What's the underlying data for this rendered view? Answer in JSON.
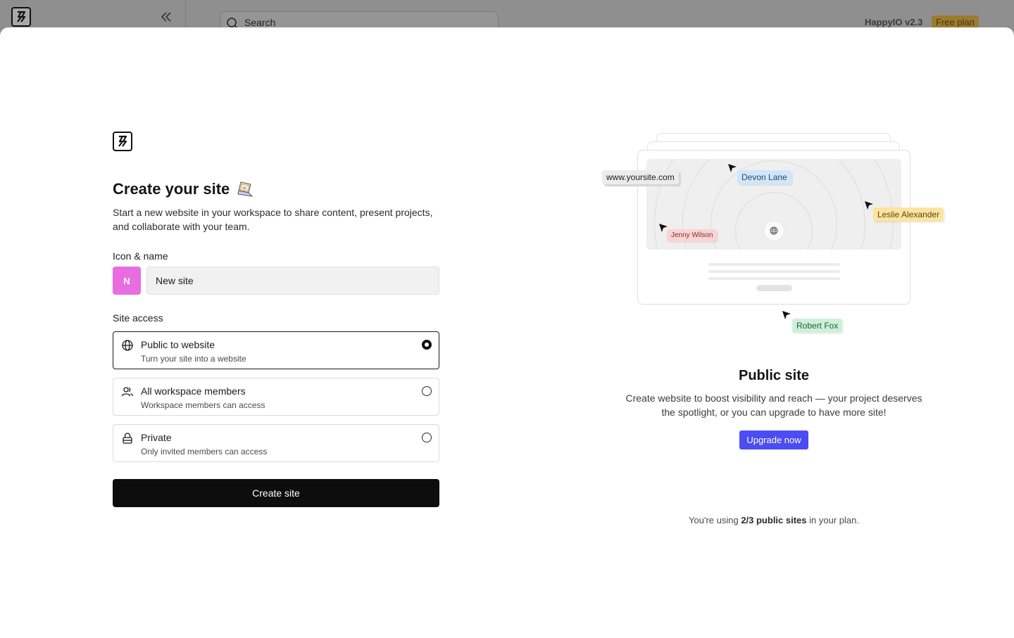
{
  "background": {
    "search_placeholder": "Search",
    "app_version": "HappyIO v2.3",
    "plan_badge": "Free plan"
  },
  "form": {
    "title": "Create your site",
    "subtitle": "Start a new website in your workspace to share content, present projects, and collaborate with your team.",
    "icon_name_label": "Icon & name",
    "icon_letter": "N",
    "name_value": "New site",
    "site_access_label": "Site access",
    "options": [
      {
        "title": "Public to website",
        "desc": "Turn your site into a website",
        "icon": "globe-icon",
        "selected": true
      },
      {
        "title": "All workspace members",
        "desc": "Workspace members can access",
        "icon": "users-icon",
        "selected": false
      },
      {
        "title": "Private",
        "desc": "Only invited members can access",
        "icon": "lock-icon",
        "selected": false
      }
    ],
    "create_label": "Create site"
  },
  "illustration": {
    "url": "www.yoursite.com",
    "collaborators": [
      "Devon Lane",
      "Leslie Alexander",
      "Jenny Wilson",
      "Robert Fox"
    ]
  },
  "promo": {
    "title": "Public site",
    "description": "Create website to boost visibility and reach — your project deserves the spotlight, or you can upgrade to have more site!",
    "upgrade_label": "Upgrade now",
    "usage_prefix": "You're using ",
    "usage_count": "2/3 public sites",
    "usage_suffix": " in your plan."
  },
  "colors": {
    "accent": "#4b4cf2",
    "site_icon": "#e86de0",
    "primary_button": "#0d0d0d"
  }
}
